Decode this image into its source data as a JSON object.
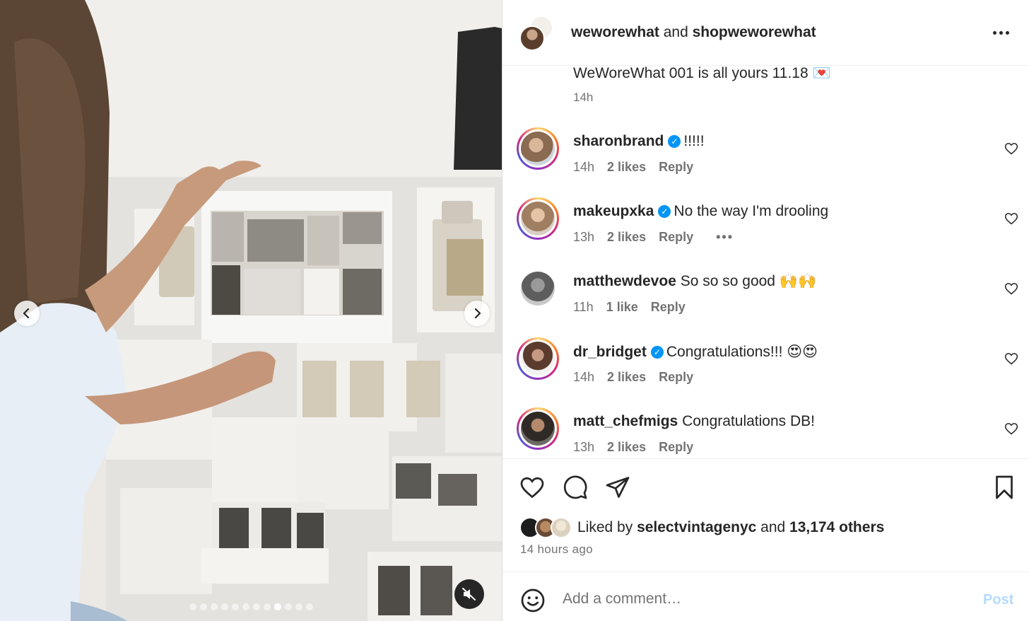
{
  "post": {
    "header": {
      "user1": "weworewhat",
      "joiner": " and ",
      "user2": "shopweworewhat"
    },
    "caption": "WeWoreWhat 001 is all yours 11.18 💌",
    "caption_time": "14h"
  },
  "comments": [
    {
      "user": "sharonbrand",
      "verified": true,
      "text": "!!!!!",
      "time": "14h",
      "likes": "2 likes",
      "reply": "Reply"
    },
    {
      "user": "makeupxka",
      "verified": true,
      "text": "No the way I'm drooling",
      "time": "13h",
      "likes": "2 likes",
      "reply": "Reply",
      "more": "•••"
    },
    {
      "user": "matthewdevoe",
      "verified": false,
      "text": "So so so good 🙌🙌",
      "time": "11h",
      "likes": "1 like",
      "reply": "Reply"
    },
    {
      "user": "dr_bridget",
      "verified": true,
      "text": "Congratulations!!! 😍😍",
      "time": "14h",
      "likes": "2 likes",
      "reply": "Reply"
    },
    {
      "user": "matt_chefmigs",
      "verified": false,
      "text": "Congratulations DB!",
      "time": "13h",
      "likes": "2 likes",
      "reply": "Reply"
    }
  ],
  "likes": {
    "prefix": "Liked by ",
    "user": "selectvintagenyc",
    "middle": " and ",
    "count": "13,174 others"
  },
  "posted_ago": "14 hours ago",
  "comment_box": {
    "placeholder": "Add a comment…",
    "post_label": "Post"
  },
  "carousel": {
    "total": 12,
    "active_index": 8
  },
  "colors": {
    "verified": "#0095f6",
    "post_disabled": "#b3dbff",
    "secondary_text": "#737373"
  }
}
